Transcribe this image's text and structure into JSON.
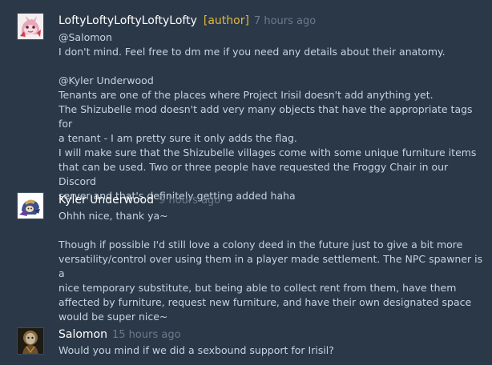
{
  "comments": [
    {
      "author": "LoftyLoftyLoftyLoftyLofty",
      "tag": "[author]",
      "time": "7 hours ago",
      "lines": [
        "@Salomon",
        "I don't mind. Feel free to dm me if you need any details about their anatomy.",
        "",
        "@Kyler Underwood",
        "Tenants are one of the places where Project Irisil doesn't add anything yet.",
        "The Shizubelle mod doesn't add very many objects that have the appropriate tags for",
        "a tenant - I am pretty sure it only adds the flag.",
        "I will make sure that the Shizubelle villages come with some unique furniture items",
        "that can be used. Two or three people have requested the Froggy Chair in our Discord",
        "server and that's definitely getting added haha"
      ]
    },
    {
      "author": "Kyler Underwood",
      "time": "9 hours ago",
      "lines": [
        "Ohhh nice, thank ya~",
        "",
        "Though if possible I'd still love a colony deed in the future just to give a bit more",
        "versatility/control over using them in a player made settlement. The NPC spawner is a",
        "nice temporary substitute, but being able to collect rent from them, have them",
        "affected by furniture, request new furniture, and have their own designated space",
        "would be super nice~"
      ]
    },
    {
      "author": "Salomon",
      "time": "15 hours ago",
      "lines": [
        "Would you mind if we did a sexbound support for Irisil?"
      ]
    }
  ]
}
